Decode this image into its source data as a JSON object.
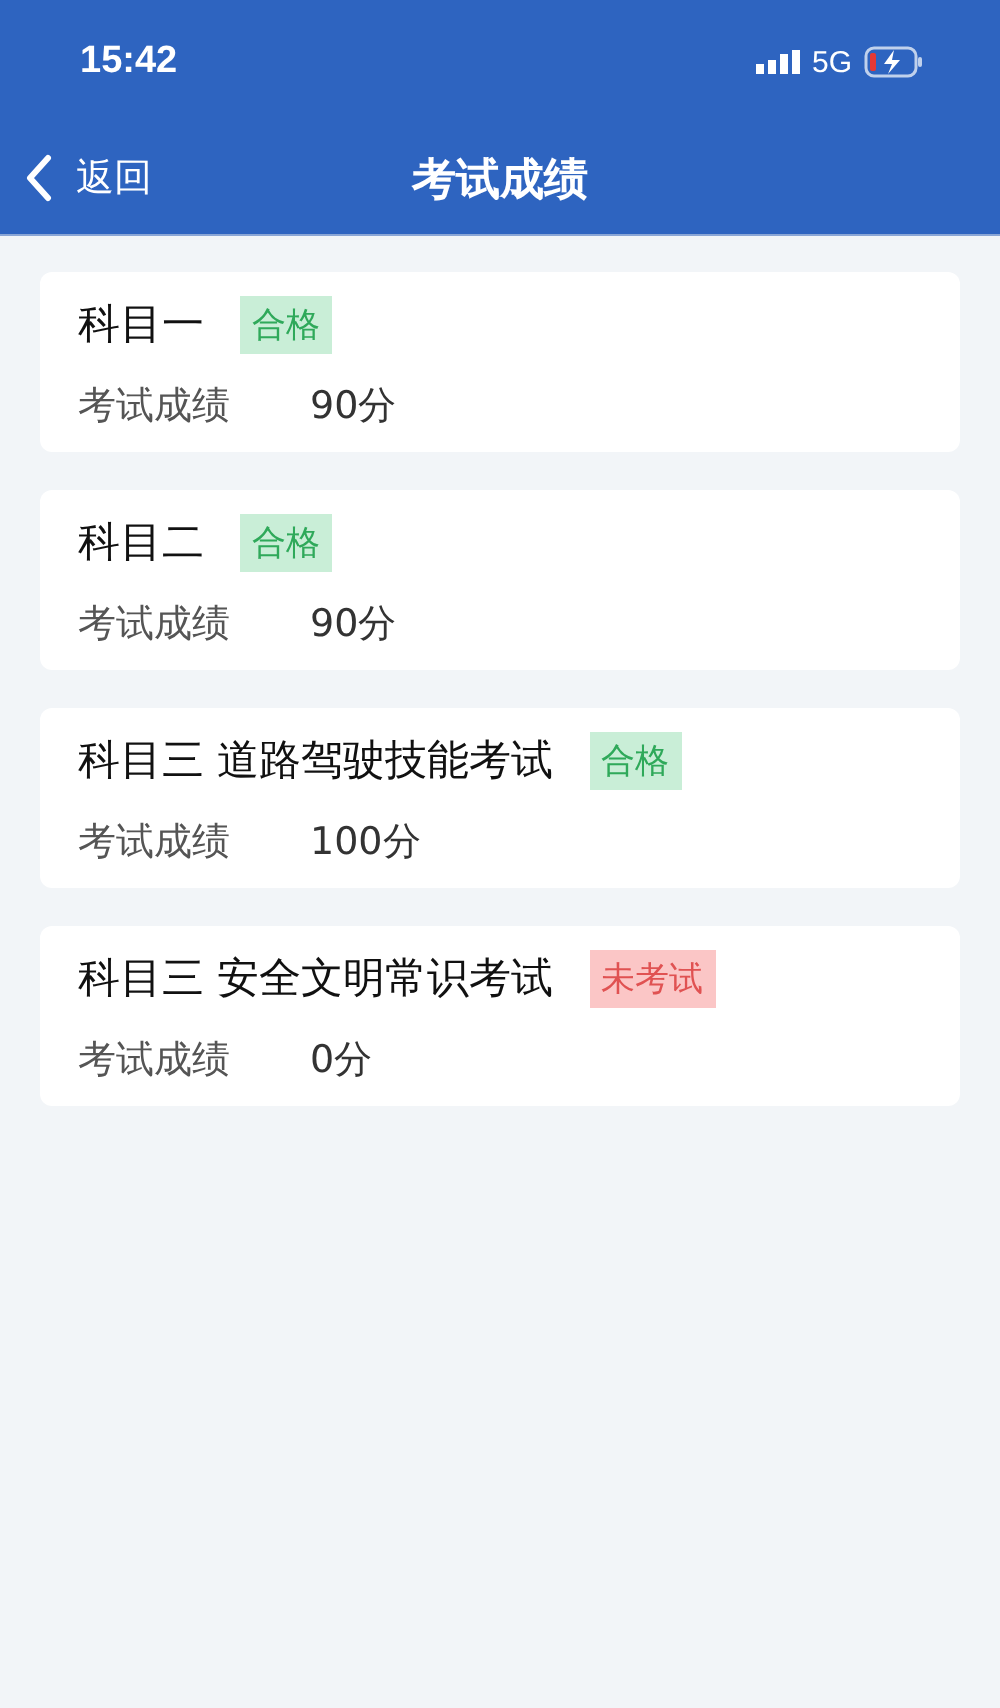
{
  "status_bar": {
    "time": "15:42",
    "network": "5G"
  },
  "nav": {
    "back": "返回",
    "title": "考试成绩"
  },
  "exams": [
    {
      "name": "科目一",
      "tag": {
        "label": "合格",
        "kind": "pass"
      },
      "score_label": "考试成绩",
      "score": "90分"
    },
    {
      "name": "科目二",
      "tag": {
        "label": "合格",
        "kind": "pass"
      },
      "score_label": "考试成绩",
      "score": "90分"
    },
    {
      "name": "科目三 道路驾驶技能考试",
      "tag": {
        "label": "合格",
        "kind": "pass"
      },
      "score_label": "考试成绩",
      "score": "100分"
    },
    {
      "name": "科目三 安全文明常识考试",
      "tag": {
        "label": "未考试",
        "kind": "absent"
      },
      "score_label": "考试成绩",
      "score": "0分"
    }
  ]
}
